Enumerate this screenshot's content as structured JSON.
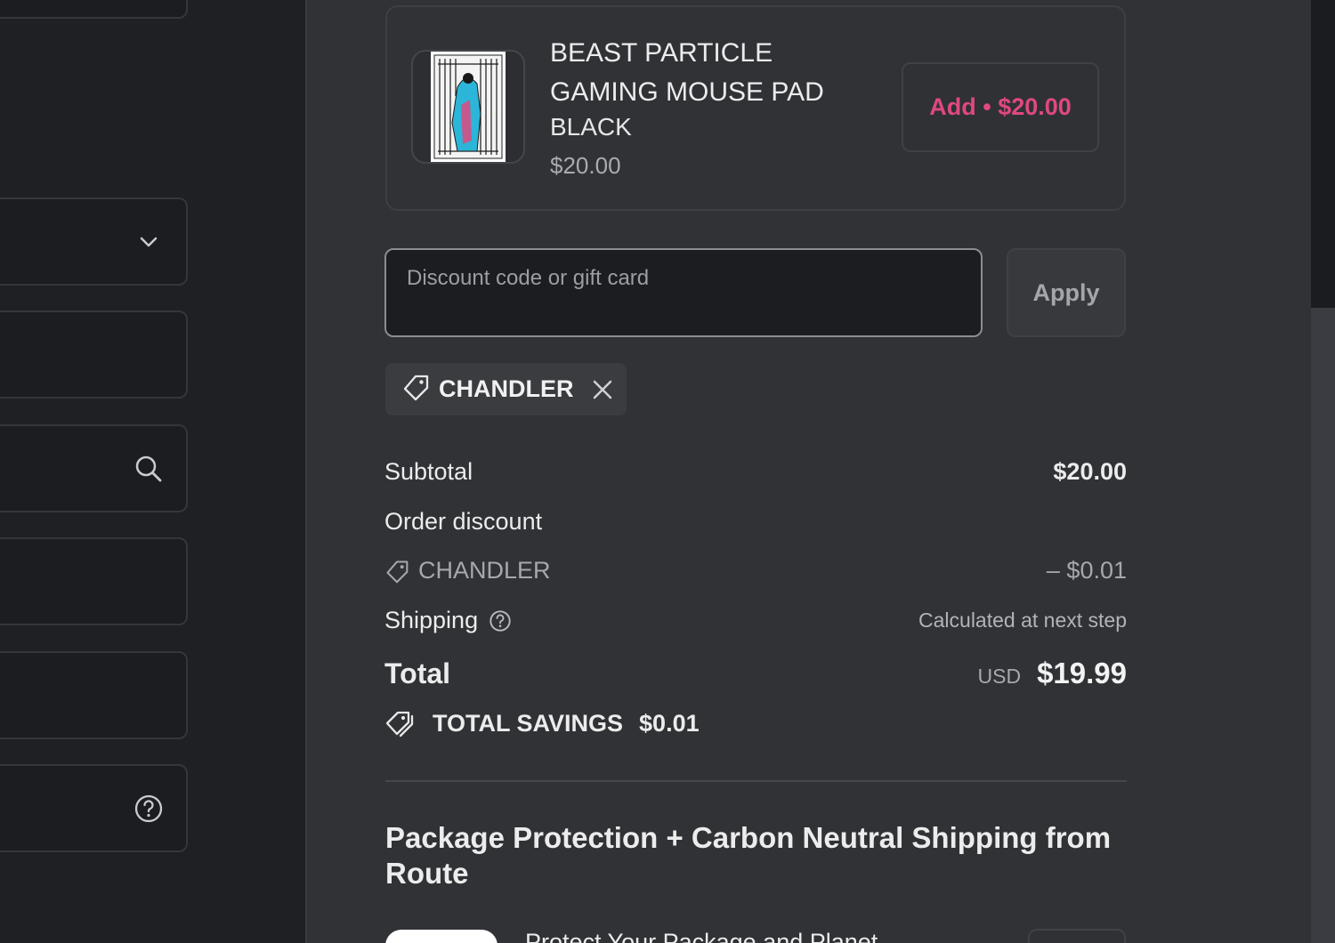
{
  "upsell": {
    "product_title": "BEAST PARTICLE GAMING MOUSE PAD",
    "variant": "BLACK",
    "price": "$20.00",
    "add_label": "Add",
    "add_separator": "•",
    "add_price": "$20.00"
  },
  "discount": {
    "placeholder": "Discount code or gift card",
    "apply_label": "Apply",
    "applied_code": "CHANDLER"
  },
  "summary": {
    "subtotal_label": "Subtotal",
    "subtotal_value": "$20.00",
    "order_discount_label": "Order discount",
    "discount_code": "CHANDLER",
    "discount_value": "– $0.01",
    "shipping_label": "Shipping",
    "shipping_value": "Calculated at next step",
    "total_label": "Total",
    "currency": "USD",
    "total_value": "$19.99",
    "savings_label": "TOTAL SAVINGS",
    "savings_value": "$0.01"
  },
  "route": {
    "title": "Package Protection + Carbon Neutral Shipping from Route",
    "option_text": "Protect Your Package and Planet"
  },
  "colors": {
    "accent": "#e0487f",
    "panel_bg": "#303236",
    "page_bg": "#1f2023"
  },
  "icons": {
    "select_chevron": "chevron-down-icon",
    "address_search": "search-icon",
    "phone_help": "help-circle-icon",
    "discount_tag": "tag-icon",
    "remove": "close-icon",
    "savings": "savings-tag-icon"
  }
}
